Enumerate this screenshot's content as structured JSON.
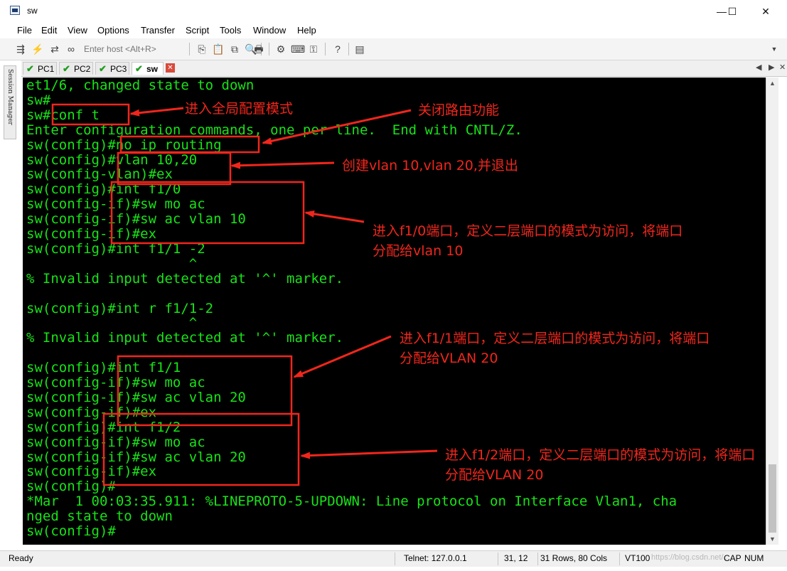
{
  "window": {
    "title": "sw",
    "minimize": "—",
    "maximize": "☐",
    "close": "✕"
  },
  "menu": [
    "File",
    "Edit",
    "View",
    "Options",
    "Transfer",
    "Script",
    "Tools",
    "Window",
    "Help"
  ],
  "toolbar": {
    "host_placeholder": "Enter host <Alt+R>"
  },
  "tabs": [
    {
      "label": "PC1",
      "active": false
    },
    {
      "label": "PC2",
      "active": false
    },
    {
      "label": "PC3",
      "active": false
    },
    {
      "label": "sw",
      "active": true
    }
  ],
  "session_manager_label": "Session Manager",
  "terminal": {
    "lines": [
      "et1/6, changed state to down",
      "sw#",
      "sw#conf t",
      "Enter configuration commands, one per line.  End with CNTL/Z.",
      "sw(config)#no ip routing",
      "sw(config)#vlan 10,20",
      "sw(config-vlan)#ex",
      "sw(config)#int f1/0",
      "sw(config-if)#sw mo ac",
      "sw(config-if)#sw ac vlan 10",
      "sw(config-if)#ex",
      "sw(config)#int f1/1 -2",
      "                    ^",
      "% Invalid input detected at '^' marker.",
      "",
      "sw(config)#int r f1/1-2",
      "                    ^",
      "% Invalid input detected at '^' marker.",
      "",
      "sw(config)#int f1/1",
      "sw(config-if)#sw mo ac",
      "sw(config-if)#sw ac vlan 20",
      "sw(config-if)#ex",
      "sw(config)#int f1/2",
      "sw(config-if)#sw mo ac",
      "sw(config-if)#sw ac vlan 20",
      "sw(config-if)#ex",
      "sw(config)#",
      "*Mar  1 00:03:35.911: %LINEPROTO-5-UPDOWN: Line protocol on Interface Vlan1, cha",
      "nged state to down",
      "sw(config)#"
    ]
  },
  "annotations": {
    "conf_t": "进入全局配置模式",
    "no_ip_routing": "关闭路由功能",
    "vlan": "创建vlan 10,vlan 20,并退出",
    "f1_0_line1": "进入f1/0端口，定义二层端口的模式为访问，将端口",
    "f1_0_line2": "分配给vlan 10",
    "f1_1_line1": "进入f1/1端口，定义二层端口的模式为访问，将端口",
    "f1_1_line2": "分配给VLAN 20",
    "f1_2_line1": "进入f1/2端口，定义二层端口的模式为访问，将端口",
    "f1_2_line2": "分配给VLAN 20"
  },
  "status": {
    "ready": "Ready",
    "connection": "Telnet: 127.0.0.1",
    "cursor": "31,  12",
    "size": "31 Rows, 80 Cols",
    "emulation": "VT100",
    "watermark": "https://blog.csdn.net/...",
    "caps": "CAP",
    "num": "NUM"
  },
  "colors": {
    "terminal_bg": "#000000",
    "terminal_fg": "#17e317",
    "annotation_red": "#f0261c"
  }
}
